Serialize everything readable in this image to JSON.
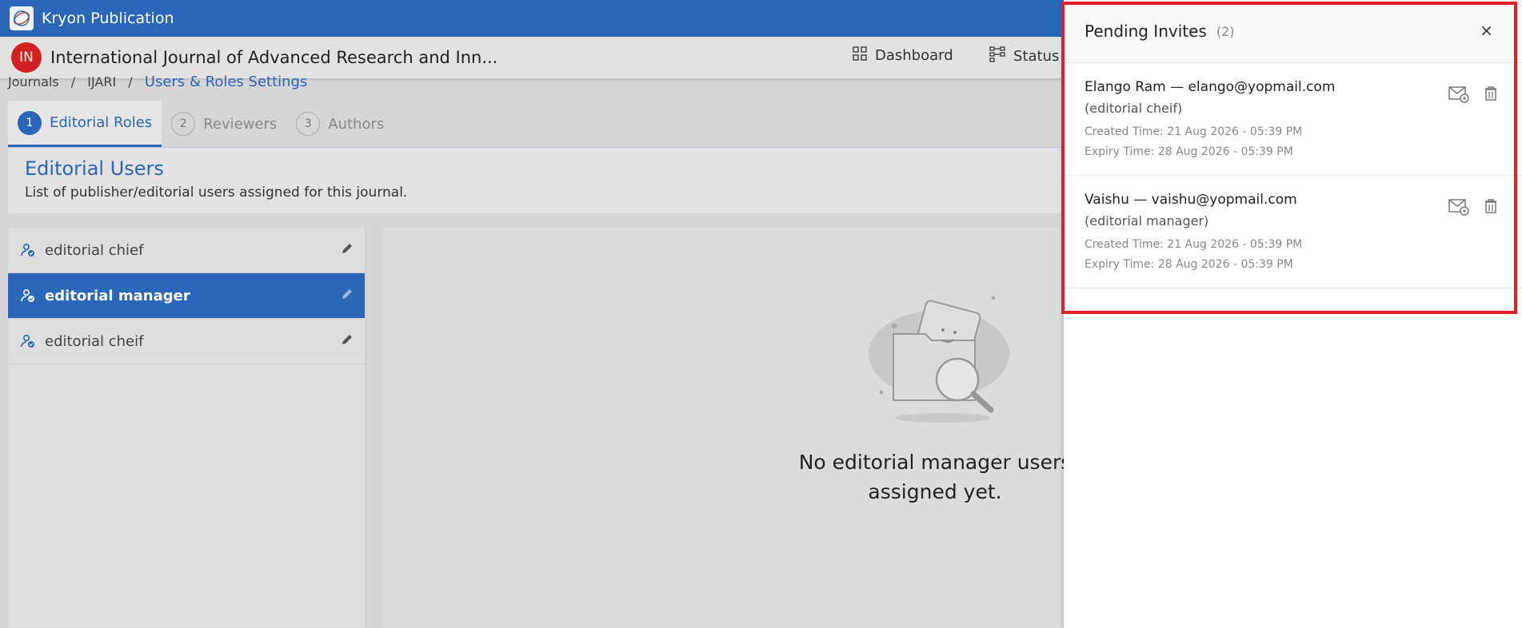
{
  "app": {
    "name": "Kryon Publication"
  },
  "journal": {
    "badge": "IN",
    "title": "International Journal of Advanced Research and Inn..."
  },
  "nav": {
    "dashboard": "Dashboard",
    "status": "Status"
  },
  "breadcrumb": {
    "journals": "Journals",
    "sep": "/",
    "journal": "IJARI",
    "current": "Users & Roles Settings"
  },
  "tabs": [
    {
      "num": "1",
      "label": "Editorial Roles"
    },
    {
      "num": "2",
      "label": "Reviewers"
    },
    {
      "num": "3",
      "label": "Authors"
    }
  ],
  "section": {
    "title": "Editorial Users",
    "subtitle": "List of publisher/editorial users assigned for this journal."
  },
  "roles": [
    {
      "label": "editorial chief"
    },
    {
      "label": "editorial manager"
    },
    {
      "label": "editorial cheif"
    }
  ],
  "empty": {
    "line1": "No editorial manager users",
    "line2": "assigned yet."
  },
  "panel": {
    "title": "Pending Invites",
    "count": "(2)",
    "close": "×",
    "invites": [
      {
        "name": "Elango Ram — elango@yopmail.com",
        "role": "(editorial cheif)",
        "created": "Created Time: 21 Aug 2026 - 05:39 PM",
        "expiry": "Expiry Time: 28 Aug 2026 - 05:39 PM"
      },
      {
        "name": "Vaishu — vaishu@yopmail.com",
        "role": "(editorial manager)",
        "created": "Created Time: 21 Aug 2026 - 05:39 PM",
        "expiry": "Expiry Time: 28 Aug 2026 - 05:39 PM"
      }
    ]
  },
  "colors": {
    "brand": "#2a67b8",
    "badge": "#d42020",
    "highlight": "#e21e2a"
  },
  "icons": {
    "logo": "app-logo-icon",
    "dashboard": "grid-icon",
    "status": "flow-icon",
    "role": "user-check-icon",
    "edit": "pencil-icon",
    "resend": "mail-resend-icon",
    "delete": "trash-icon",
    "empty": "folder-search-illustration"
  }
}
